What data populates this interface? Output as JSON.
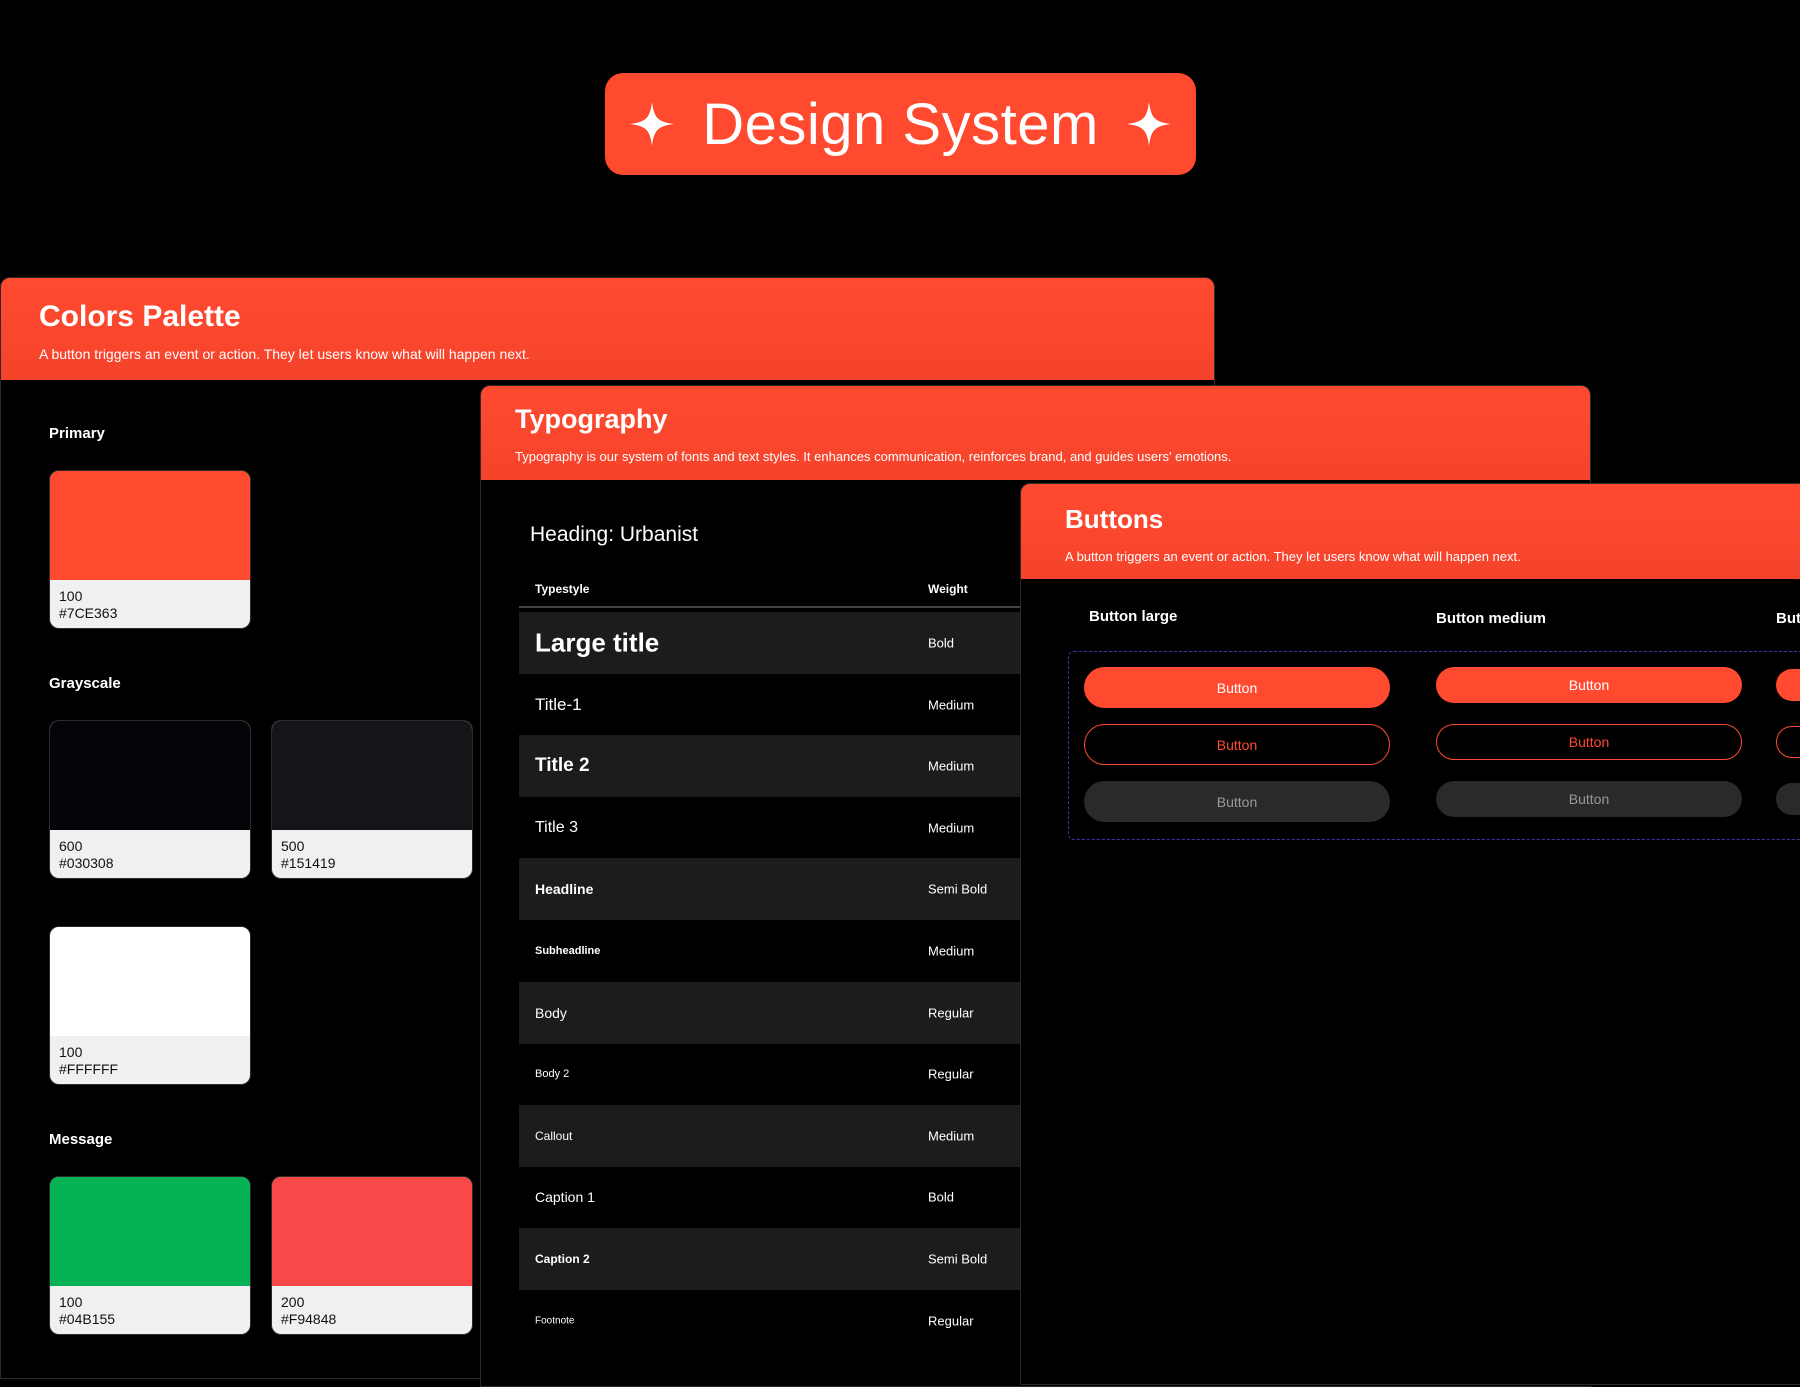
{
  "title": "Design System",
  "colors": {
    "heading": "Colors Palette",
    "description": "A button triggers an event or action. They let users know what will happen next.",
    "sections": {
      "primary": "Primary",
      "grayscale": "Grayscale",
      "message": "Message"
    },
    "swatches": [
      {
        "level": "100",
        "code": "#7CE363",
        "color": "#ff4a30"
      },
      {
        "level": "600",
        "code": "#030308",
        "color": "#030308"
      },
      {
        "level": "500",
        "code": "#151419",
        "color": "#151419"
      },
      {
        "level": "100",
        "code": "#FFFFFF",
        "color": "#FFFFFF"
      },
      {
        "level": "100",
        "code": "#04B155",
        "color": "#04B155"
      },
      {
        "level": "200",
        "code": "#F94848",
        "color": "#F94848"
      }
    ]
  },
  "typography": {
    "heading": "Typography",
    "description": "Typography is our system of fonts and text styles. It enhances communication, reinforces brand, and guides users' emotions.",
    "font_heading": "Heading: Urbanist",
    "columns": {
      "typestyle": "Typestyle",
      "weight": "Weight"
    },
    "rows": [
      {
        "name": "Large title",
        "weight": "Bold"
      },
      {
        "name": "Title-1",
        "weight": "Medium"
      },
      {
        "name": "Title 2",
        "weight": "Medium"
      },
      {
        "name": "Title 3",
        "weight": "Medium"
      },
      {
        "name": "Headline",
        "weight": "Semi Bold"
      },
      {
        "name": "Subheadline",
        "weight": "Medium"
      },
      {
        "name": "Body",
        "weight": "Regular"
      },
      {
        "name": "Body 2",
        "weight": "Regular"
      },
      {
        "name": "Callout",
        "weight": "Medium"
      },
      {
        "name": "Caption 1",
        "weight": "Bold"
      },
      {
        "name": "Caption 2",
        "weight": "Semi Bold"
      },
      {
        "name": "Footnote",
        "weight": "Regular"
      }
    ]
  },
  "buttons": {
    "heading": "Buttons",
    "description": "A button triggers an event or action. They let users know what will happen next.",
    "columns": [
      "Button large",
      "Button medium",
      "But"
    ],
    "label": "Button"
  },
  "accent": "#ff4a30"
}
